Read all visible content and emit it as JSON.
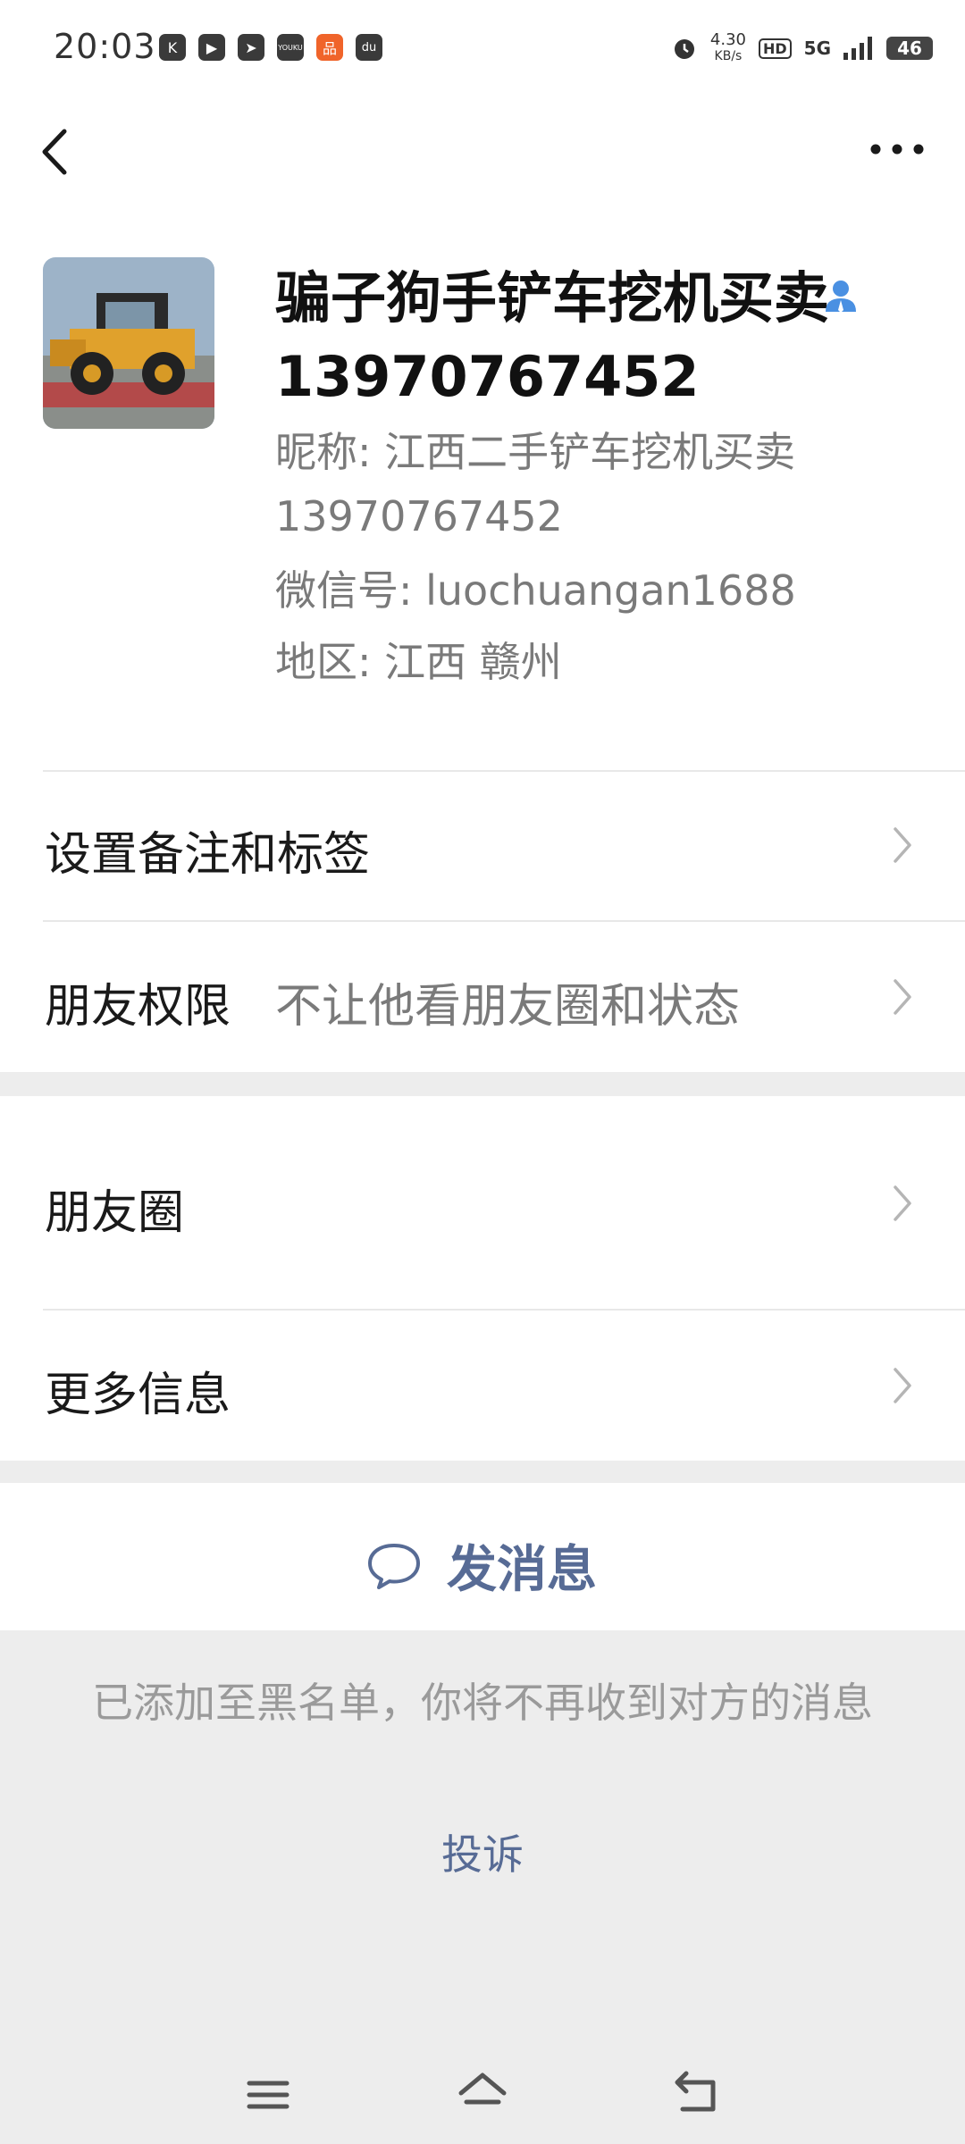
{
  "status_bar": {
    "time": "20:03",
    "apps": [
      "K",
      "▶",
      "➤",
      "YOUKU",
      "品",
      "du"
    ],
    "net_speed": "4.30",
    "net_unit": "KB/s",
    "hd": "HD",
    "signal": "5G",
    "battery": "46"
  },
  "profile": {
    "name": "骗子狗手铲车挖机买卖13970767452",
    "nickname": "昵称: 江西二手铲车挖机买卖13970767452",
    "wechat_id": "微信号: luochuangan1688",
    "region": "地区: 江西  赣州"
  },
  "rows": {
    "remark": {
      "label": "设置备注和标签"
    },
    "permission": {
      "label": "朋友权限",
      "value": "不让他看朋友圈和状态"
    },
    "moments": {
      "label": "朋友圈"
    },
    "more_info": {
      "label": "更多信息"
    }
  },
  "send_message": {
    "label": "发消息"
  },
  "blacklist_notice": "已添加至黑名单，你将不再收到对方的消息",
  "complain": "投诉",
  "colors": {
    "link_blue": "#576b95",
    "background_gray": "#ededed"
  }
}
